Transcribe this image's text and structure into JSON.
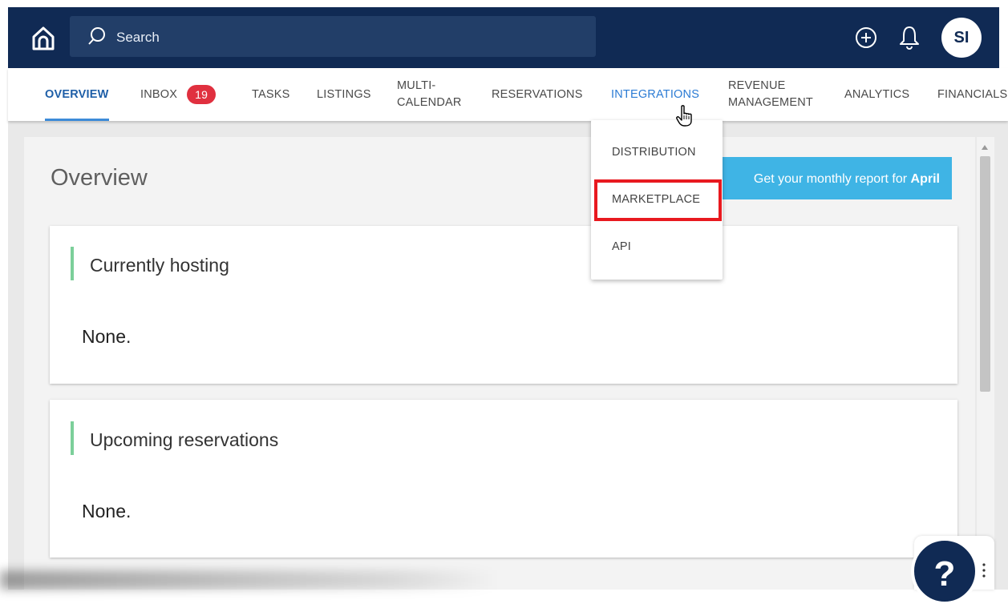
{
  "search": {
    "placeholder": "Search"
  },
  "user": {
    "initials": "SI"
  },
  "nav": {
    "overview": "OVERVIEW",
    "inbox": "INBOX",
    "inbox_count": "19",
    "tasks": "TASKS",
    "listings": "LISTINGS",
    "multi_calendar_1": "MULTI-",
    "multi_calendar_2": "CALENDAR",
    "reservations": "RESERVATIONS",
    "integrations": "INTEGRATIONS",
    "revenue_1": "REVENUE",
    "revenue_2": "MANAGEMENT",
    "analytics": "ANALYTICS",
    "financials": "FINANCIALS"
  },
  "dropdown": {
    "items": [
      "DISTRIBUTION",
      "MARKETPLACE",
      "API"
    ]
  },
  "main": {
    "title": "Overview",
    "report_text": "Get your monthly report for",
    "report_month": "April",
    "cards": [
      {
        "title": "Currently hosting",
        "body": "None."
      },
      {
        "title": "Upcoming reservations",
        "body": "None."
      }
    ]
  },
  "help": {
    "label": "?"
  },
  "colors": {
    "topbar": "#102a54",
    "accent_blue": "#3d8bd8",
    "badge_red": "#e0303f",
    "report_button": "#3fb4e5",
    "card_accent_green": "#7ccf9a",
    "highlight_red": "#e8191f"
  },
  "icons": [
    "home-icon",
    "search-icon",
    "plus-circle-icon",
    "bell-icon",
    "pointer-cursor-icon",
    "help-icon",
    "more-vertical-icon"
  ]
}
